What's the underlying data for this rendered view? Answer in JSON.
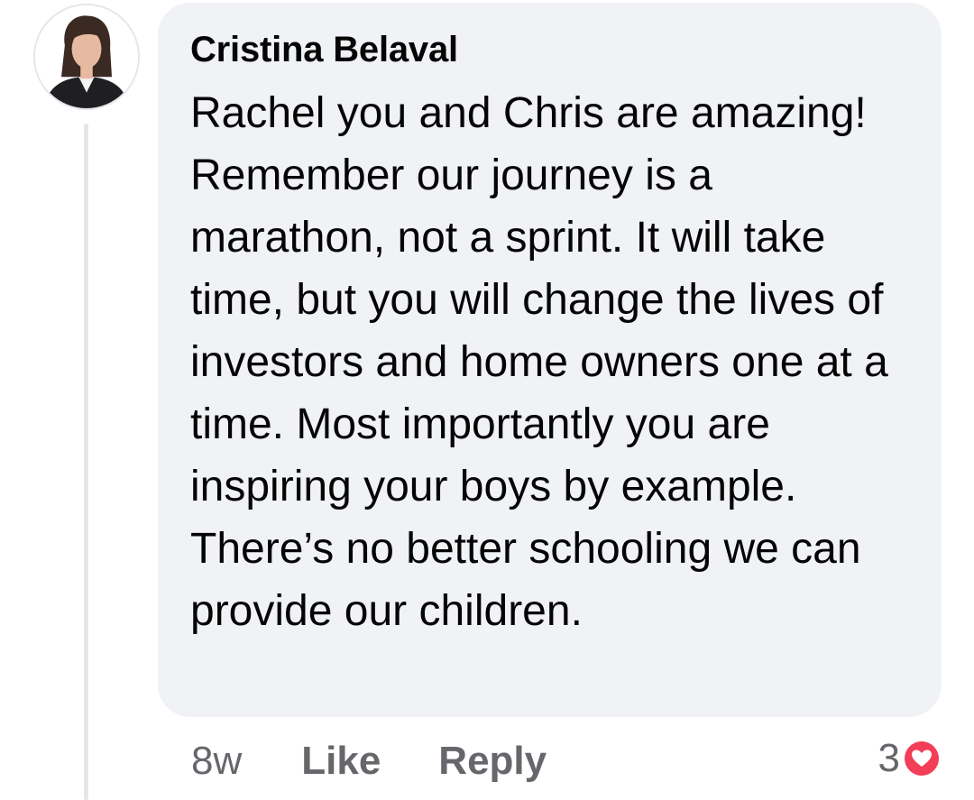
{
  "comment": {
    "author": "Cristina Belaval",
    "text": "Rachel you and Chris are amazing! Remember our journey is a marathon, not a sprint. It will take time, but you will change the lives of investors and home owners one at a time. Most importantly you are inspiring your boys by example. There’s no better schooling we can provide our children.",
    "avatar_icon": "profile-photo"
  },
  "actions": {
    "timestamp": "8w",
    "like_label": "Like",
    "reply_label": "Reply"
  },
  "reactions": {
    "count": "3",
    "icon": "love-reaction-icon",
    "color": "#f33e58"
  },
  "colors": {
    "bubble": "#f0f2f5",
    "text": "#050505",
    "secondary_text": "#65676b",
    "thread_line": "#e4e6eb"
  }
}
